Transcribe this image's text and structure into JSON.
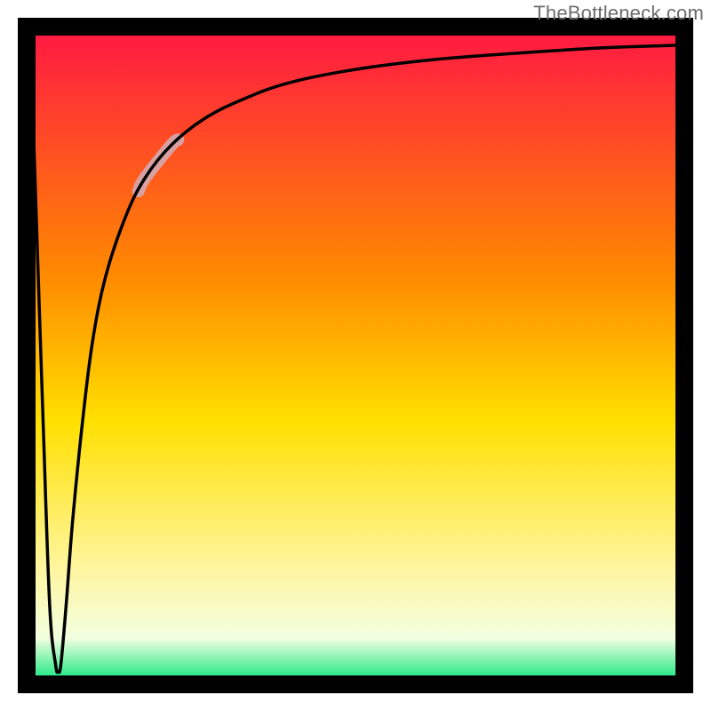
{
  "watermark": "TheBottleneck.com",
  "colors": {
    "gradient_top": "#ff1744",
    "gradient_mid_top": "#ff8a00",
    "gradient_mid": "#ffe000",
    "gradient_mid_bottom": "#fff59d",
    "gradient_bottom_band": "#f2ffe0",
    "gradient_bottom": "#00e676",
    "curve": "#000000",
    "highlight": "#d8a0a0",
    "axis": "#000000"
  },
  "chart_data": {
    "type": "line",
    "title": "",
    "xlabel": "",
    "ylabel": "",
    "xlim": [
      0,
      100
    ],
    "ylim": [
      0,
      100
    ],
    "highlight_segment_x": [
      17,
      23
    ],
    "curve": [
      {
        "x": 0.5,
        "y": 100
      },
      {
        "x": 1.5,
        "y": 70
      },
      {
        "x": 2.5,
        "y": 40
      },
      {
        "x": 3.5,
        "y": 12
      },
      {
        "x": 4.4,
        "y": 3
      },
      {
        "x": 4.8,
        "y": 2
      },
      {
        "x": 5.2,
        "y": 3
      },
      {
        "x": 6.0,
        "y": 12
      },
      {
        "x": 7.0,
        "y": 25
      },
      {
        "x": 8.5,
        "y": 40
      },
      {
        "x": 10.0,
        "y": 52
      },
      {
        "x": 12.0,
        "y": 62
      },
      {
        "x": 15.0,
        "y": 71
      },
      {
        "x": 18.0,
        "y": 77
      },
      {
        "x": 22.0,
        "y": 82
      },
      {
        "x": 27.0,
        "y": 86
      },
      {
        "x": 33.0,
        "y": 89
      },
      {
        "x": 40.0,
        "y": 91.5
      },
      {
        "x": 50.0,
        "y": 93.5
      },
      {
        "x": 62.0,
        "y": 95
      },
      {
        "x": 75.0,
        "y": 96
      },
      {
        "x": 88.0,
        "y": 96.8
      },
      {
        "x": 100.0,
        "y": 97.2
      }
    ]
  }
}
